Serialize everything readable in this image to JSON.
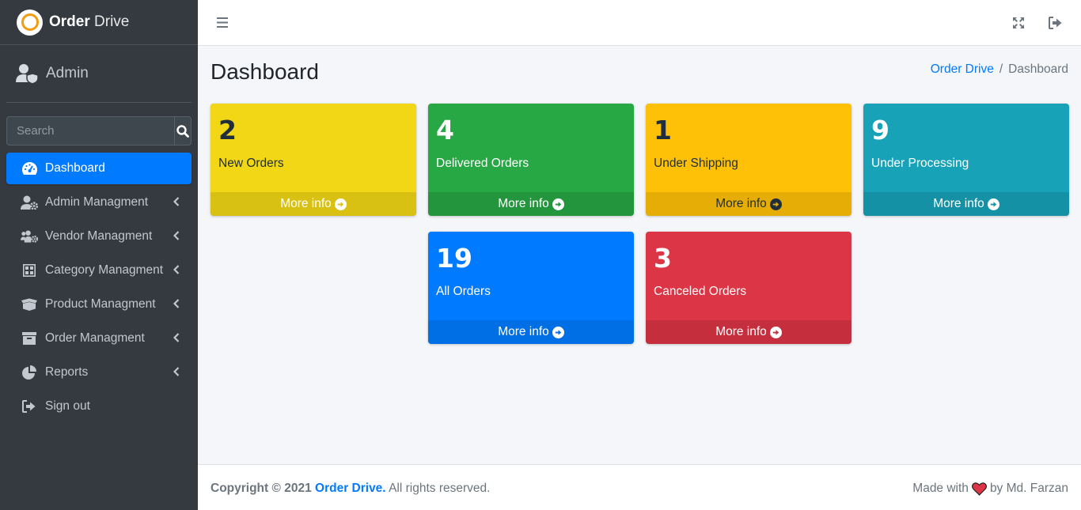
{
  "brand": {
    "name_bold": "Order",
    "name_light": "Drive"
  },
  "user": {
    "name": "Admin"
  },
  "search": {
    "placeholder": "Search"
  },
  "nav": [
    {
      "label": "Dashboard",
      "icon": "tachometer-icon",
      "active": true
    },
    {
      "label": "Admin Managment",
      "icon": "user-cog-icon"
    },
    {
      "label": "Vendor Managment",
      "icon": "users-cog-icon"
    },
    {
      "label": "Category Managment",
      "icon": "th-large-icon"
    },
    {
      "label": "Product Managment",
      "icon": "box-open-icon"
    },
    {
      "label": "Order Managment",
      "icon": "archive-icon"
    },
    {
      "label": "Reports",
      "icon": "chart-pie-icon"
    },
    {
      "label": "Sign out",
      "icon": "sign-out-icon"
    }
  ],
  "page": {
    "title": "Dashboard"
  },
  "breadcrumb": {
    "home": "Order Drive",
    "separator": "/",
    "current": "Dashboard"
  },
  "boxes": [
    {
      "count": "2",
      "label": "New Orders",
      "more": "More info",
      "color": "#f1d716"
    },
    {
      "count": "4",
      "label": "Delivered Orders",
      "more": "More info",
      "color": "#28a745"
    },
    {
      "count": "1",
      "label": "Under Shipping",
      "more": "More info",
      "color": "#ffc107"
    },
    {
      "count": "9",
      "label": "Under Processing",
      "more": "More info",
      "color": "#17a2b8"
    },
    {
      "count": "19",
      "label": "All Orders",
      "more": "More info",
      "color": "#007bff"
    },
    {
      "count": "3",
      "label": "Canceled Orders",
      "more": "More info",
      "color": "#dc3545"
    }
  ],
  "footer": {
    "copyright": "Copyright © 2021",
    "brand": "Order Drive.",
    "rights": "All rights reserved.",
    "made_with": "Made with",
    "by": "by Md. Farzan"
  }
}
